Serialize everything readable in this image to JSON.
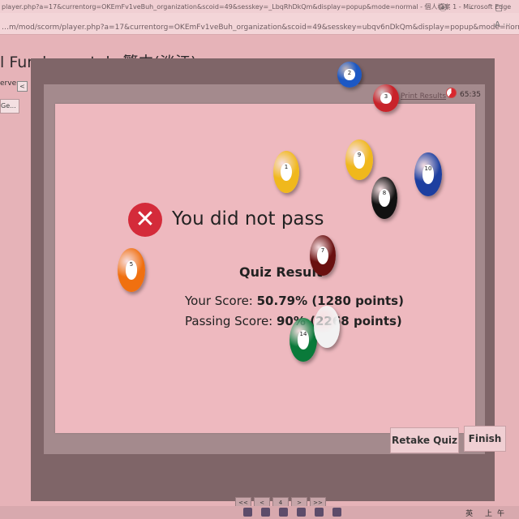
{
  "browser": {
    "window_title": "player.php?a=17&currentorg=OKEmFv1veBuh_organization&scoid=49&sesskey=_LbqRhDkQm&display=popup&mode=normal - 個人檔案 1 - Microsoft Edge",
    "url": "…m/mod/scorm/player.php?a=17&currentorg=OKEmFv1veBuh_organization&scoid=49&sesskey=ubqv6nDkQm&display=popup&mode=normal"
  },
  "course": {
    "title": "l Fundamentals 繁中(淡江)"
  },
  "sidebar": {
    "server_label": "erver",
    "collapse_glyph": "<",
    "item_label": "Ge..."
  },
  "player_toolbar": {
    "print_results": "Print Results",
    "timer": "65:35"
  },
  "result": {
    "message": "You did not pass",
    "section_title": "Quiz Result",
    "score_label": "Your Score: ",
    "score_value": "50.79% (1280 points)",
    "passing_label": "Passing Score: ",
    "passing_value": "90% (2268 points)"
  },
  "buttons": {
    "retake": "Retake Quiz",
    "finish": "Finish"
  },
  "pager": {
    "first": "<<",
    "prev": "<",
    "page": "4",
    "next": ">",
    "last": ">>"
  },
  "taskbar": {
    "tray_text": "英 上午"
  },
  "colors": {
    "fail_red": "#d42b3a",
    "card_bg": "#eeb9bf",
    "frame": "#7f6568"
  },
  "overlay_balls": [
    {
      "number": "2",
      "color": "#1c58c4"
    },
    {
      "number": "3",
      "color": "#c8232a"
    },
    {
      "number": "1",
      "color": "#f0b81c"
    },
    {
      "number": "9",
      "color": "#f0b81c"
    },
    {
      "number": "8",
      "color": "#111111"
    },
    {
      "number": "10",
      "color": "#1d3fa0"
    },
    {
      "number": "5",
      "color": "#f07010"
    },
    {
      "number": "7",
      "color": "#6a1010"
    },
    {
      "number": "14",
      "color": "#0a7a3a"
    },
    {
      "number": "",
      "color": "#f2f2f2"
    }
  ]
}
